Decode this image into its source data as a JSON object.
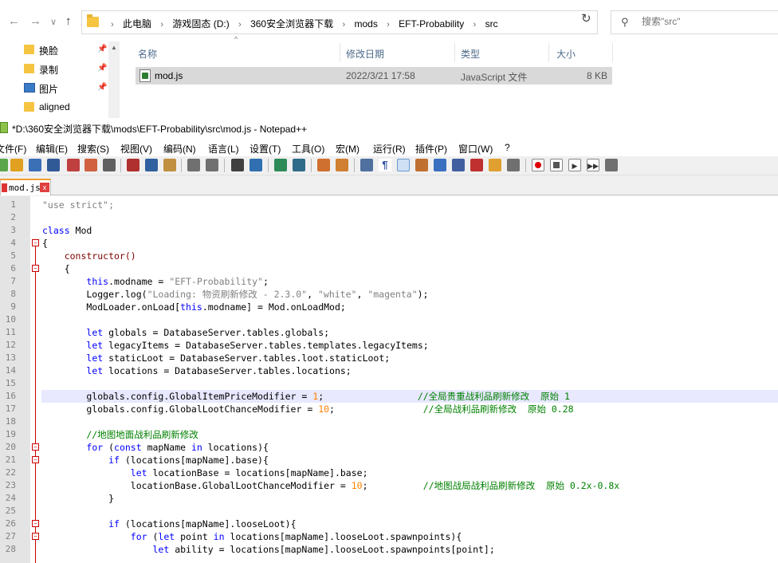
{
  "explorer": {
    "nav": {
      "back": "←",
      "forward": "→",
      "dropdown": "∨",
      "up": "↑"
    },
    "breadcrumb": [
      "此电脑",
      "游戏固态 (D:)",
      "360安全浏览器下载",
      "mods",
      "EFT-Probability",
      "src"
    ],
    "search_placeholder": "搜索\"src\"",
    "quick_access": [
      {
        "label": "换脸",
        "type": "folder"
      },
      {
        "label": "录制",
        "type": "folder"
      },
      {
        "label": "图片",
        "type": "image"
      },
      {
        "label": "aligned",
        "type": "folder"
      }
    ],
    "columns": [
      "名称",
      "修改日期",
      "类型",
      "大小"
    ],
    "files": [
      {
        "name": "mod.js",
        "date": "2022/3/21 17:58",
        "type": "JavaScript 文件",
        "size": "8 KB"
      }
    ]
  },
  "npp": {
    "title": "*D:\\360安全浏览器下载\\mods\\EFT-Probability\\src\\mod.js - Notepad++",
    "menus": [
      "文件(F)",
      "编辑(E)",
      "搜索(S)",
      "视图(V)",
      "编码(N)",
      "语言(L)",
      "设置(T)",
      "工具(O)",
      "宏(M)",
      "运行(R)",
      "插件(P)",
      "窗口(W)",
      "?"
    ],
    "tab": {
      "label": "mod.js",
      "close": "x"
    },
    "line_numbers": [
      "1",
      "2",
      "3",
      "4",
      "5",
      "6",
      "7",
      "8",
      "9",
      "10",
      "11",
      "12",
      "13",
      "14",
      "15",
      "16",
      "17",
      "18",
      "19",
      "20",
      "21",
      "22",
      "23",
      "24",
      "25",
      "26",
      "27",
      "28"
    ],
    "current_line": 16,
    "lines": [
      "\"use strict\";",
      "",
      "class Mod",
      "{",
      "    constructor()",
      "    {",
      "        this.modname = \"EFT-Probability\";",
      "        Logger.log(\"Loading: 物资刷新修改 - 2.3.0\", \"white\", \"magenta\");",
      "        ModLoader.onLoad[this.modname] = Mod.onLoadMod;",
      "",
      "        let globals = DatabaseServer.tables.globals;",
      "        let legacyItems = DatabaseServer.tables.templates.legacyItems;",
      "        let staticLoot = DatabaseServer.tables.loot.staticLoot;",
      "        let locations = DatabaseServer.tables.locations;",
      "",
      "        globals.config.GlobalItemPriceModifier = 1;                 //全局贵重战利品刷新修改  原始 1",
      "        globals.config.GlobalLootChanceModifier = 10;                //全局战利品刷新修改  原始 0.28",
      "",
      "        //地图地面战利品刷新修改",
      "        for (const mapName in locations){",
      "            if (locations[mapName].base){",
      "                let locationBase = locations[mapName].base;",
      "                locationBase.GlobalLootChanceModifier = 10;          //地图战局战利品刷新修改  原始 0.2x-0.8x",
      "            }",
      "",
      "            if (locations[mapName].looseLoot){",
      "                for (let point in locations[mapName].looseLoot.spawnpoints){",
      "                    let ability = locations[mapName].looseLoot.spawnpoints[point];"
    ]
  }
}
